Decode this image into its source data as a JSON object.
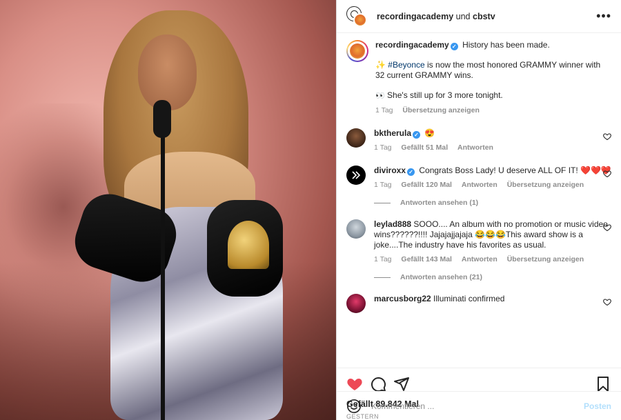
{
  "header": {
    "account": "recordingacademy",
    "connector": "und",
    "collab": "cbstv"
  },
  "caption": {
    "username": "recordingacademy",
    "line1": "History has been made.",
    "sparkle": "✨",
    "hashtag": "#Beyonce",
    "line2": "is now the most honored GRAMMY winner with 32 current GRAMMY wins.",
    "eyes": "👀",
    "line3": "She's still up for 3 more tonight.",
    "time": "1 Tag",
    "translate": "Übersetzung anzeigen"
  },
  "comments": [
    {
      "username": "bktherula",
      "verified": true,
      "text": "😍",
      "time": "1 Tag",
      "likes": "Gefällt 51 Mal",
      "reply": "Antworten",
      "translate": ""
    },
    {
      "username": "diviroxx",
      "verified": true,
      "text": "Congrats Boss Lady! U deserve ALL OF IT! ❤️❤️❤️",
      "time": "1 Tag",
      "likes": "Gefällt 120 Mal",
      "reply": "Antworten",
      "translate": "Übersetzung anzeigen",
      "replies": "Antworten ansehen (1)"
    },
    {
      "username": "leylad888",
      "verified": false,
      "text": "SOOO.... An album with no promotion or music video wins??????!!!! Jajajajjajaja 😂😂😂This award show is a joke....The industry have his favorites as usual.",
      "time": "1 Tag",
      "likes": "Gefällt 143 Mal",
      "reply": "Antworten",
      "translate": "Übersetzung anzeigen",
      "replies": "Antworten ansehen (21)"
    },
    {
      "username": "marcusborg22",
      "verified": false,
      "text": "Illuminati confirmed"
    }
  ],
  "post_likes": "Gefällt 89.842 Mal",
  "post_date": "GESTERN",
  "comment_input": {
    "placeholder": "Kommentieren ...",
    "post_label": "Posten"
  },
  "colors": {
    "link": "#00376b",
    "verified": "#3897f0",
    "liked": "#ed4956",
    "post_button_disabled": "#b2dffc"
  }
}
